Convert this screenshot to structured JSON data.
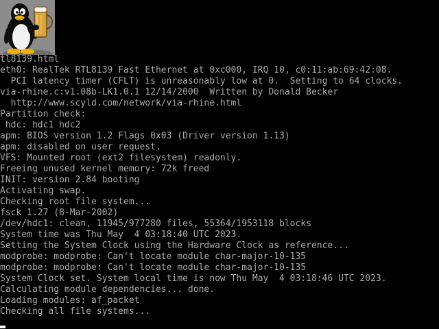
{
  "colors": {
    "background": "#000000",
    "text": "#aaaaaa",
    "cursor": "#ffffff"
  },
  "logo": {
    "icon": "tux-penguin-with-beer-icon"
  },
  "console": {
    "lines": [
      "tl8139.html",
      "eth0: RealTek RTL8139 Fast Ethernet at 0xc000, IRQ 10, c0:11:ab:69:42:08.",
      "  PCI latency timer (CFLT) is unreasonably low at 0.  Setting to 64 clocks.",
      "via-rhine.c:v1.08b-LK1.0.1 12/14/2000  Written by Donald Becker",
      "  http://www.scyld.com/network/via-rhine.html",
      "Partition check:",
      " hdc: hdc1 hdc2",
      "apm: BIOS version 1.2 Flags 0x03 (Driver version 1.13)",
      "apm: disabled on user request.",
      "VFS: Mounted root (ext2 filesystem) readonly.",
      "Freeing unused kernel memory: 72k freed",
      "INIT: version 2.84 booting",
      "Activating swap.",
      "Checking root file system...",
      "fsck 1.27 (8-Mar-2002)",
      "/dev/hdc1: clean, 11945/977280 files, 55364/1953118 blocks",
      "System time was Thu May  4 03:18:40 UTC 2023.",
      "Setting the System Clock using the Hardware Clock as reference...",
      "modprobe: modprobe: Can't locate module char-major-10-135",
      "modprobe: modprobe: Can't locate module char-major-10-135",
      "System Clock set. System local time is now Thu May  4 03:18:46 UTC 2023.",
      "Calculating module dependencies... done.",
      "Loading modules: af_packet",
      "Checking all file systems..."
    ]
  }
}
